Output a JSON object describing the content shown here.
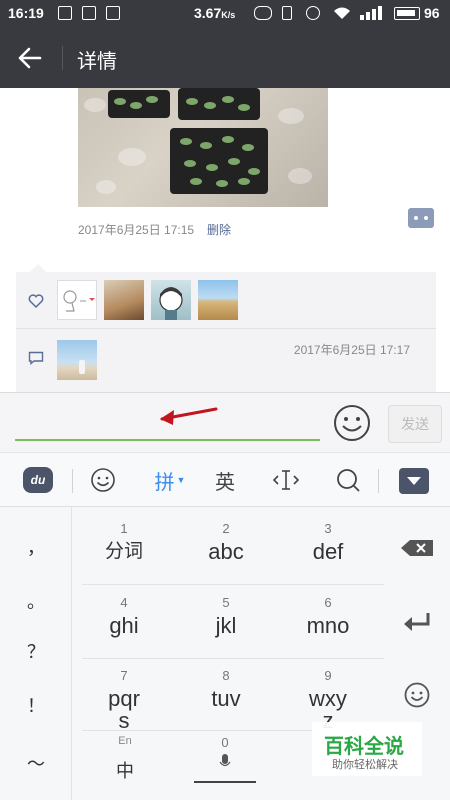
{
  "status_bar": {
    "time": "16:19",
    "net_speed": "3.67",
    "net_speed_unit": "K/s",
    "battery": "96"
  },
  "header": {
    "title": "详情",
    "back_icon": "arrow-left-icon"
  },
  "post": {
    "timestamp": "2017年6月25日 17:15",
    "delete_label": "删除",
    "more_icon": "more-dots-icon"
  },
  "likes": {
    "icon": "heart-icon",
    "avatar_count": 4
  },
  "comments": {
    "icon": "comment-icon",
    "timestamp": "2017年6月25日 17:17"
  },
  "input_bar": {
    "value": "",
    "emoji_icon": "smiley-icon",
    "send_label": "发送",
    "accent_color": "#7bbf5a",
    "annotation_arrow_color": "#c0161f"
  },
  "ime_toolbar": {
    "logo_label": "du",
    "emoji_icon": "smiley-outline-icon",
    "pinyin_label": "拼",
    "english_label": "英",
    "cursor_icon": "text-cursor-icon",
    "search_icon": "search-icon",
    "collapse_icon": "keyboard-collapse-icon",
    "active_color": "#3b8cf0"
  },
  "keyboard": {
    "punctuation": [
      "，",
      "。",
      "？",
      "！",
      "～"
    ],
    "keys": [
      {
        "num": "1",
        "label": "分词"
      },
      {
        "num": "2",
        "label": "abc"
      },
      {
        "num": "3",
        "label": "def"
      },
      {
        "num": "4",
        "label": "ghi"
      },
      {
        "num": "5",
        "label": "jkl"
      },
      {
        "num": "6",
        "label": "mno"
      },
      {
        "num": "7",
        "label": "pqrs"
      },
      {
        "num": "8",
        "label": "tuv"
      },
      {
        "num": "9",
        "label": "wxyz"
      }
    ],
    "zh_key_small": "En",
    "zh_key_main": "中",
    "space_num": "0",
    "space_icon": "microphone-icon",
    "backspace_icon": "backspace-icon",
    "enter_icon": "enter-icon",
    "emoji_icon": "emoji-key-icon"
  },
  "watermark": {
    "main": "百科全说",
    "sub": "助你轻松解决"
  }
}
